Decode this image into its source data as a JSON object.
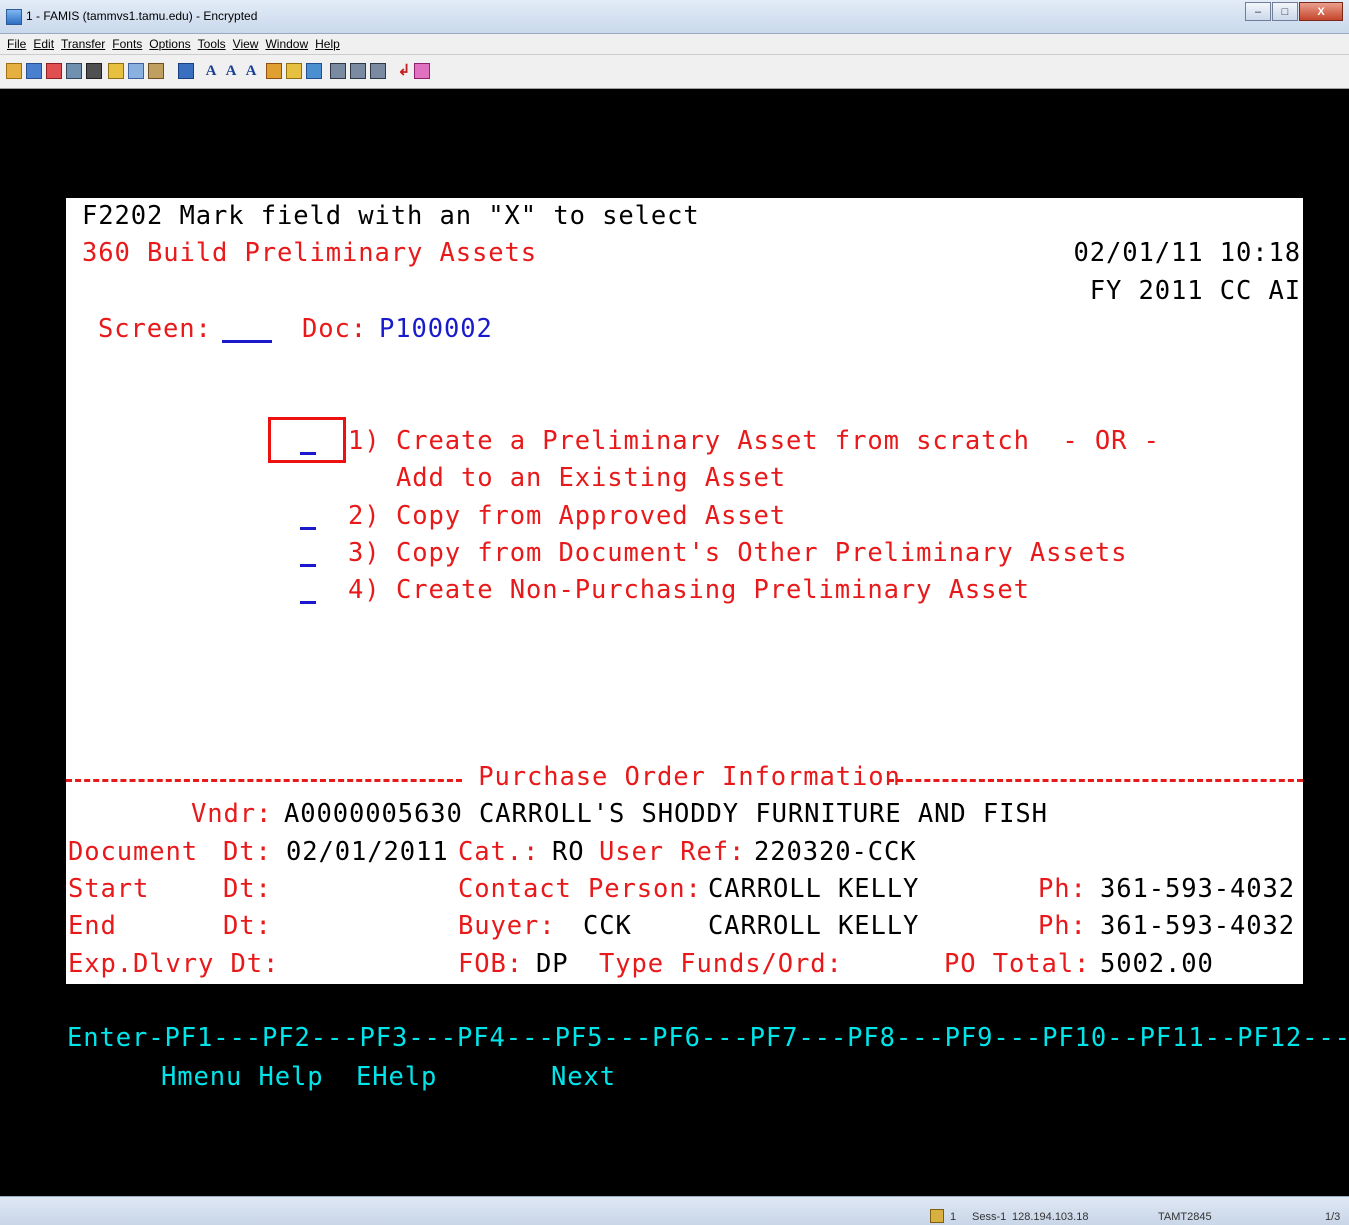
{
  "window": {
    "title": "1 - FAMIS (tammvs1.tamu.edu) - Encrypted"
  },
  "menu": [
    "File",
    "Edit",
    "Transfer",
    "Fonts",
    "Options",
    "Tools",
    "View",
    "Window",
    "Help"
  ],
  "screen": {
    "header_line": "F2202 Mark field with an \"X\" to select",
    "screen_title": "360 Build Preliminary Assets",
    "datetime": "02/01/11 10:18",
    "fy_line": "FY 2011 CC AI",
    "screen_label": "Screen:",
    "screen_value": "",
    "doc_label": "Doc:",
    "doc_value": "P100002",
    "options": [
      {
        "number": "1)",
        "text": "Create a Preliminary Asset from scratch  - OR -",
        "continuation": "Add to an Existing Asset"
      },
      {
        "number": "2)",
        "text": "Copy from Approved Asset"
      },
      {
        "number": "3)",
        "text": "Copy from Document's Other Preliminary Assets"
      },
      {
        "number": "4)",
        "text": "Create Non-Purchasing Preliminary Asset"
      }
    ],
    "po_section_title": " Purchase Order Information ",
    "po": {
      "vndr_label": "Vndr:",
      "vndr_value": "A0000005630 CARROLL'S SHODDY FURNITURE AND FISH",
      "document_label": "Document",
      "dt_label": "Dt:",
      "document_dt": "02/01/2011",
      "cat_label": "Cat.:",
      "cat_value": "RO",
      "user_ref_label": "User Ref:",
      "user_ref_value": "220320-CCK",
      "start_label": "Start",
      "contact_label": "Contact Person:",
      "contact_value": "CARROLL KELLY",
      "ph_label": "Ph:",
      "contact_ph": "361-593-4032",
      "end_label": "End",
      "buyer_label": "Buyer:",
      "buyer_code": "CCK",
      "buyer_name": "CARROLL KELLY",
      "buyer_ph": "361-593-4032",
      "exp_label": "Exp.Dlvry Dt:",
      "fob_label": "FOB:",
      "fob_value": "DP",
      "type_funds_label": "Type Funds/Ord:",
      "po_total_label": "PO Total:",
      "po_total_value": "5002.00"
    }
  },
  "pfkeys": {
    "line1": "Enter-PF1---PF2---PF3---PF4---PF5---PF6---PF7---PF8---PF9---PF10--PF11--PF12---",
    "line2": "Hmenu Help  EHelp       Next"
  },
  "status": {
    "lock": "1",
    "session": "Sess-1",
    "ip": "128.194.103.18",
    "terminal": "TAMT2845",
    "page": "1/3"
  }
}
